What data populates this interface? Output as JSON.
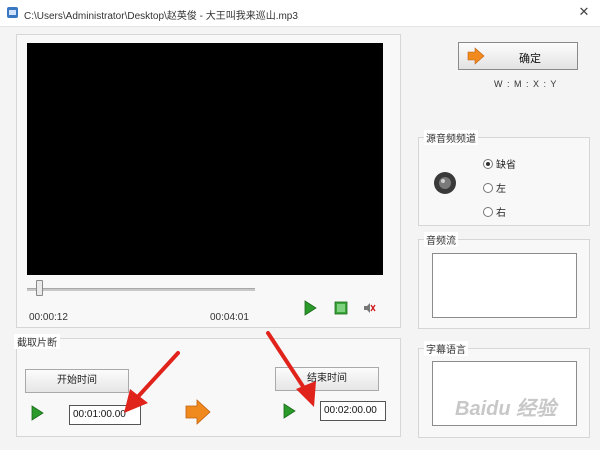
{
  "window": {
    "title": "C:\\Users\\Administrator\\Desktop\\赵英俊 - 大王叫我来巡山.mp3",
    "close_glyph": "✕"
  },
  "player": {
    "current_time": "00:00:12",
    "total_time": "00:04:01",
    "progress_fraction": 0.05
  },
  "clip": {
    "group_label": "截取片断",
    "start_button": "开始时间",
    "end_button": "结束时间",
    "start_value": "00:01:00.00",
    "end_value": "00:02:00.00"
  },
  "ok": {
    "label": "确定"
  },
  "format_hint": "W : M : X : Y",
  "audio_channel": {
    "label": "源音频频道",
    "options": [
      "缺省",
      "左",
      "右"
    ],
    "selected": 0
  },
  "audio_stream": {
    "label": "音频流"
  },
  "subtitle": {
    "label": "字幕语言"
  },
  "watermark": "Baidu 经验",
  "colors": {
    "accent_orange": "#f08a1e",
    "play_green": "#2a9a2a",
    "arrow_red": "#e0231b"
  }
}
